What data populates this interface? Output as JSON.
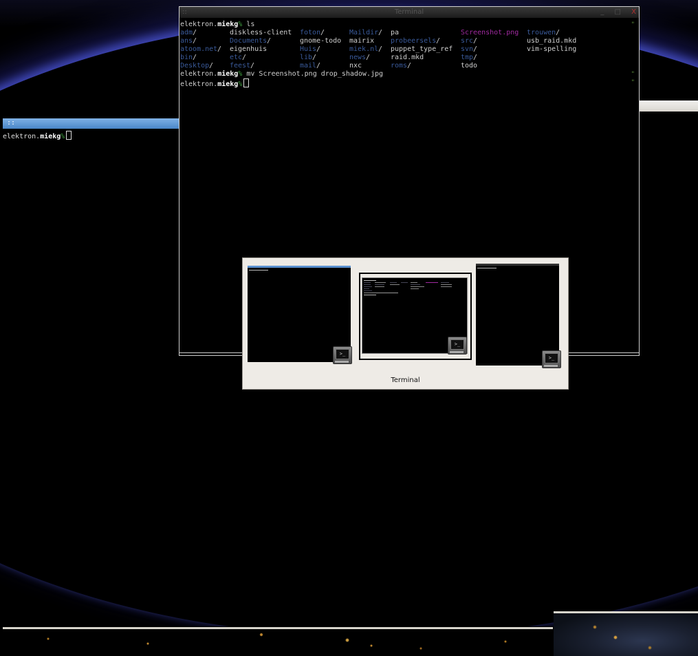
{
  "wallpaper": {
    "description_colors": {
      "horizon": "#4650c8",
      "lights": "#c08830"
    }
  },
  "left_terminal": {
    "grip": "::",
    "prompt_host": "elektron.",
    "prompt_user": "miekg",
    "prompt_pct": "%"
  },
  "main_terminal": {
    "title": "Terminal",
    "grip": "::",
    "buttons": "_ □ ",
    "close": "X",
    "command1": "ls",
    "command2": "mv Screenshot.png drop_shadow.jpg",
    "prompt_host": "elektron.",
    "prompt_user": "miekg",
    "prompt_pct": "%",
    "ls_rows": [
      [
        {
          "t": "adm",
          "k": "dir"
        },
        {
          "t": "diskless-client",
          "k": "plain"
        },
        {
          "t": "foton",
          "k": "dir"
        },
        {
          "t": "Maildir",
          "k": "dir"
        },
        {
          "t": "pa",
          "k": "plain"
        },
        {
          "t": "Screenshot.png",
          "k": "img"
        },
        {
          "t": "trouwen",
          "k": "dir"
        }
      ],
      [
        {
          "t": "ans",
          "k": "dir"
        },
        {
          "t": "Documents",
          "k": "dir"
        },
        {
          "t": "gnome-todo",
          "k": "plain"
        },
        {
          "t": "mairix",
          "k": "plain"
        },
        {
          "t": "probeersels",
          "k": "dir"
        },
        {
          "t": "src",
          "k": "dir"
        },
        {
          "t": "usb_raid.mkd",
          "k": "plain"
        }
      ],
      [
        {
          "t": "atoom.net",
          "k": "dir"
        },
        {
          "t": "eigenhuis",
          "k": "plain"
        },
        {
          "t": "Huis",
          "k": "dir"
        },
        {
          "t": "miek.nl",
          "k": "dir"
        },
        {
          "t": "puppet_type_ref",
          "k": "plain"
        },
        {
          "t": "svn",
          "k": "dir"
        },
        {
          "t": "vim-spelling",
          "k": "plain"
        }
      ],
      [
        {
          "t": "bin",
          "k": "dir"
        },
        {
          "t": "etc",
          "k": "dir"
        },
        {
          "t": "lib",
          "k": "dir"
        },
        {
          "t": "news",
          "k": "dir"
        },
        {
          "t": "raid.mkd",
          "k": "plain"
        },
        {
          "t": "tmp",
          "k": "dir"
        },
        {
          "t": "",
          "k": "plain"
        }
      ],
      [
        {
          "t": "Desktop",
          "k": "dir"
        },
        {
          "t": "feest",
          "k": "dir"
        },
        {
          "t": "mail",
          "k": "dir"
        },
        {
          "t": "nxc",
          "k": "plain"
        },
        {
          "t": "roms",
          "k": "dir"
        },
        {
          "t": "todo",
          "k": "plain"
        },
        {
          "t": "",
          "k": "plain"
        }
      ]
    ],
    "right_mark": "\""
  },
  "switcher": {
    "label": "Terminal",
    "icon_glyph": ">_"
  }
}
